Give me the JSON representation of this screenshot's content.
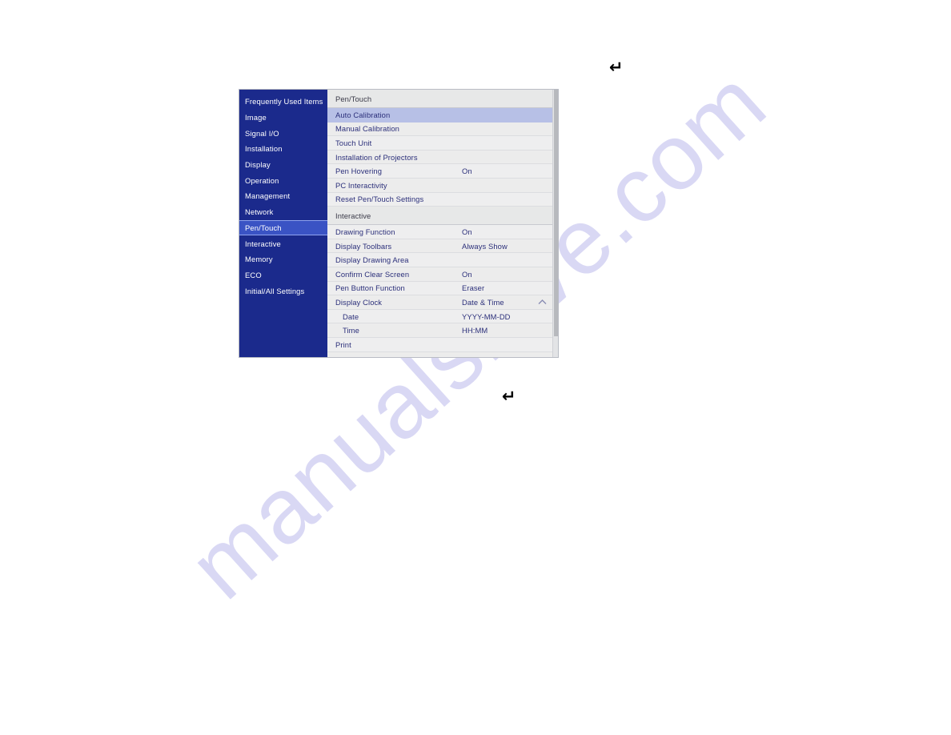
{
  "watermark": {
    "text": "manualshive.com"
  },
  "glyphs": {
    "enter_top": "↵",
    "enter_bottom": "↵"
  },
  "osd": {
    "sidebar": {
      "items": [
        {
          "label": "Frequently Used Items",
          "selected": false
        },
        {
          "label": "Image",
          "selected": false
        },
        {
          "label": "Signal I/O",
          "selected": false
        },
        {
          "label": "Installation",
          "selected": false
        },
        {
          "label": "Display",
          "selected": false
        },
        {
          "label": "Operation",
          "selected": false
        },
        {
          "label": "Management",
          "selected": false
        },
        {
          "label": "Network",
          "selected": false
        },
        {
          "label": "Pen/Touch",
          "selected": true
        },
        {
          "label": "Interactive",
          "selected": false
        },
        {
          "label": "Memory",
          "selected": false
        },
        {
          "label": "ECO",
          "selected": false
        },
        {
          "label": "Initial/All Settings",
          "selected": false
        }
      ]
    },
    "sections": [
      {
        "header": "Pen/Touch",
        "rows": [
          {
            "label": "Auto Calibration",
            "value": "",
            "highlight": true
          },
          {
            "label": "Manual Calibration",
            "value": ""
          },
          {
            "label": "Touch Unit",
            "value": ""
          },
          {
            "label": "Installation of Projectors",
            "value": ""
          },
          {
            "label": "Pen Hovering",
            "value": "On"
          },
          {
            "label": "PC Interactivity",
            "value": ""
          },
          {
            "label": "Reset Pen/Touch Settings",
            "value": ""
          }
        ]
      },
      {
        "header": "Interactive",
        "rows": [
          {
            "label": "Drawing Function",
            "value": "On"
          },
          {
            "label": "Display Toolbars",
            "value": "Always Show"
          },
          {
            "label": "Display Drawing Area",
            "value": ""
          },
          {
            "label": "Confirm Clear Screen",
            "value": "On"
          },
          {
            "label": "Pen Button Function",
            "value": "Eraser"
          },
          {
            "label": "Display Clock",
            "value": "Date & Time",
            "chevron": "chevron-up-icon"
          },
          {
            "label": "Date",
            "value": "YYYY-MM-DD",
            "sub": true
          },
          {
            "label": "Time",
            "value": "HH:MM",
            "sub": true
          },
          {
            "label": "Print",
            "value": ""
          }
        ]
      }
    ],
    "colors": {
      "sidebar_bg": "#1b2a8c",
      "sidebar_selected": "#3a53c4",
      "row_highlight": "#b7c0e6",
      "row_text": "#2b2f7a",
      "section_header_bg": "#e7e8e8"
    }
  }
}
